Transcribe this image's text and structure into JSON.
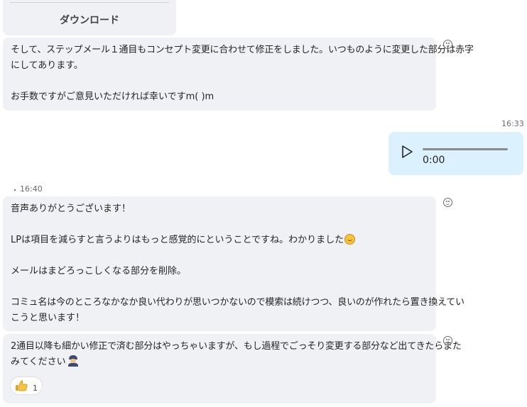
{
  "download_card": {
    "label": "ダウンロード"
  },
  "messages": [
    {
      "lines": [
        "そして、ステップメール１通目もコンセプト変更に合わせて修正をしました。いつものように変更した部分は赤字",
        "にしてあります。",
        "",
        "お手数ですがご意見いただければ幸いですm( )m"
      ]
    },
    {
      "time": "16:33",
      "audio": {
        "elapsed": "0:00",
        "progress": 0
      }
    },
    {
      "time": "16:40",
      "lines": [
        "音声ありがとうございます！",
        "",
        "LPは項目を減らすと言うよりはもっと感覚的にということですね。わかりました",
        "",
        "メールはまどろっこしくなる部分を削除。",
        "",
        "コミュ名は今のところなかなか良い代わりが思いつかないので模索は続けつつ、良いのが作れたら置き換えてい",
        "こうと思います！"
      ],
      "emoji": "smile-emoji"
    },
    {
      "lines": [
        "2通目以降も細かい修正で済む部分はやっちゃいますが、もし過程でごっそり変更する部分など出てきたらまた",
        "みてください"
      ],
      "emoji": "police-emoji",
      "reaction": {
        "icon": "thumbs-up-emoji",
        "count": "1"
      }
    }
  ]
}
